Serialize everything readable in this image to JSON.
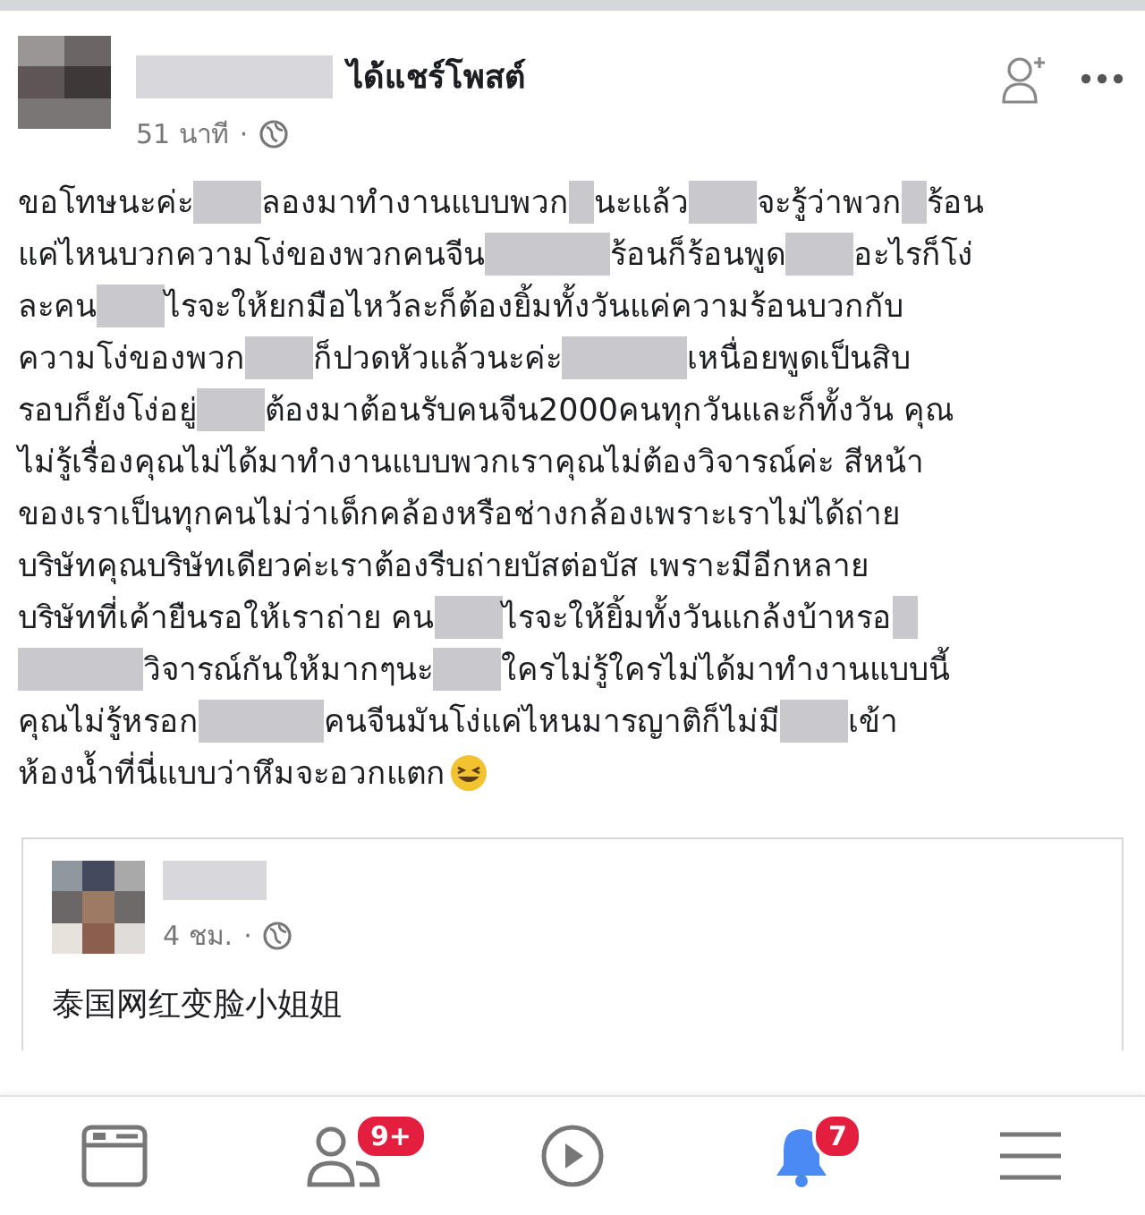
{
  "post": {
    "action": "ได้แชร์โพสต์",
    "time": "51 นาที",
    "separator": "·",
    "lines": [
      [
        {
          "kind": "text",
          "text": "ขอโทษนะค่ะ"
        },
        {
          "kind": "blur-medium"
        },
        {
          "kind": "text",
          "text": "ลองมาทำงานแบบพวก"
        },
        {
          "kind": "blur-short"
        },
        {
          "kind": "text",
          "text": "นะแล้ว"
        },
        {
          "kind": "blur-medium"
        },
        {
          "kind": "text",
          "text": "จะรู้ว่าพวก"
        },
        {
          "kind": "blur-short"
        },
        {
          "kind": "text",
          "text": "ร้อน"
        }
      ],
      [
        {
          "kind": "text",
          "text": "แค่ไหนบวกความโง่ของพวกคนจีน"
        },
        {
          "kind": "blur-long"
        },
        {
          "kind": "text",
          "text": "ร้อนก็ร้อนพูด"
        },
        {
          "kind": "blur-medium"
        },
        {
          "kind": "text",
          "text": "อะไรก็โง่"
        }
      ],
      [
        {
          "kind": "text",
          "text": "ละคน"
        },
        {
          "kind": "blur-medium"
        },
        {
          "kind": "text",
          "text": "ไรจะให้ยกมือไหว้ละก็ต้องยิ้มทั้งวันแค่ความร้อนบวกกับ"
        }
      ],
      [
        {
          "kind": "text",
          "text": "ความโง่ของพวก"
        },
        {
          "kind": "blur-medium"
        },
        {
          "kind": "text",
          "text": "ก็ปวดหัวแล้วนะค่ะ"
        },
        {
          "kind": "blur-long"
        },
        {
          "kind": "text",
          "text": "เหนื่อยพูดเป็นสิบ"
        }
      ],
      [
        {
          "kind": "text",
          "text": "รอบก็ยังโง่อยู่"
        },
        {
          "kind": "blur-medium"
        },
        {
          "kind": "text",
          "text": "ต้องมาต้อนรับคนจีน2000คนทุกวันและก็ทั้งวัน คุณ"
        }
      ],
      [
        {
          "kind": "text",
          "text": "ไม่รู้เรื่องคุณไม่ได้มาทำงานแบบพวกเราคุณไม่ต้องวิจารณ์ค่ะ สีหน้า"
        }
      ],
      [
        {
          "kind": "text",
          "text": "ของเราเป็นทุกคนไม่ว่าเด็กคล้องหรือช่างกล้องเพราะเราไม่ได้ถ่าย"
        }
      ],
      [
        {
          "kind": "text",
          "text": "บริษัทคุณบริษัทเดียวค่ะเราต้องรีบถ่ายบัสต่อบัส เพราะมีอีกหลาย"
        }
      ],
      [
        {
          "kind": "text",
          "text": "บริษัทที่เค้ายืนรอให้เราถ่าย คน"
        },
        {
          "kind": "blur-medium"
        },
        {
          "kind": "text",
          "text": "ไรจะให้ยิ้มทั้งวันแกล้งบ้าหรอ"
        },
        {
          "kind": "blur-short"
        }
      ],
      [
        {
          "kind": "blur-long"
        },
        {
          "kind": "text",
          "text": "วิจารณ์กันให้มากๆนะ"
        },
        {
          "kind": "blur-medium"
        },
        {
          "kind": "text",
          "text": "ใครไม่รู้ใครไม่ได้มาทำงานแบบนี้"
        }
      ],
      [
        {
          "kind": "text",
          "text": "คุณไม่รู้หรอก"
        },
        {
          "kind": "blur-long"
        },
        {
          "kind": "text",
          "text": "คนจีนมันโง่แค่ไหนมารญาติก็ไม่มี"
        },
        {
          "kind": "blur-medium"
        },
        {
          "kind": "text",
          "text": "เข้า"
        }
      ],
      [
        {
          "kind": "text",
          "text": "ห้องน้ำที่นี่แบบว่าหึมจะอวกแตก"
        },
        {
          "kind": "emoji"
        }
      ]
    ]
  },
  "comment": {
    "time": "4 ชม.",
    "separator": "·",
    "text": "泰国网红变脸小姐姐"
  },
  "nav": [
    {
      "kind": "feed",
      "selected": false
    },
    {
      "kind": "friends",
      "selected": false,
      "badge": "9+"
    },
    {
      "kind": "video",
      "selected": false
    },
    {
      "kind": "bell",
      "selected": true,
      "badge": "7"
    },
    {
      "kind": "menu",
      "selected": false
    }
  ]
}
